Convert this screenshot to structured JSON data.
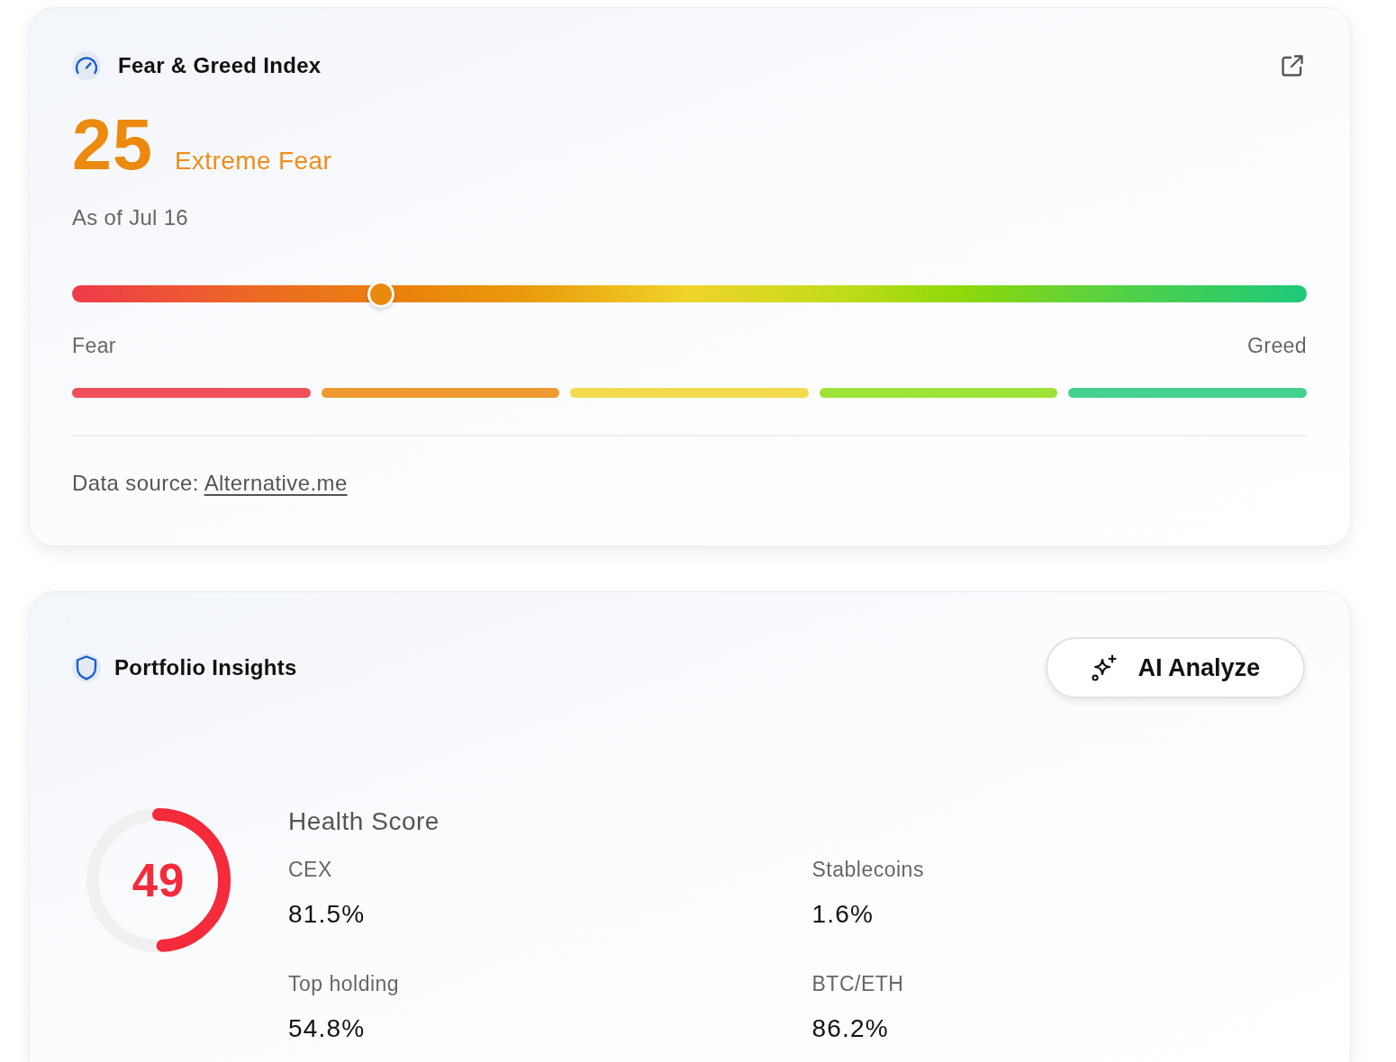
{
  "fear_greed": {
    "title": "Fear & Greed Index",
    "value": "25",
    "label": "Extreme Fear",
    "as_of": "As of Jul 16",
    "level": 0.25,
    "scale_min_label": "Fear",
    "scale_max_label": "Greed",
    "segments": [
      {
        "color": "#ef5059"
      },
      {
        "color": "#ee9a30"
      },
      {
        "color": "#f3da4c"
      },
      {
        "color": "#9ee23a"
      },
      {
        "color": "#44d18f"
      }
    ],
    "source_label": "Data source:",
    "source_link": "Alternative.me"
  },
  "portfolio_insights": {
    "title": "Portfolio Insights",
    "button": "AI Analyze",
    "health": {
      "score": "49",
      "level": 0.49,
      "title": "Health Score",
      "metrics": [
        {
          "label": "CEX",
          "value": "81.5%"
        },
        {
          "label": "Stablecoins",
          "value": "1.6%"
        },
        {
          "label": "Top holding",
          "value": "54.8%"
        },
        {
          "label": "BTC/ETH",
          "value": "86.2%"
        }
      ]
    }
  }
}
